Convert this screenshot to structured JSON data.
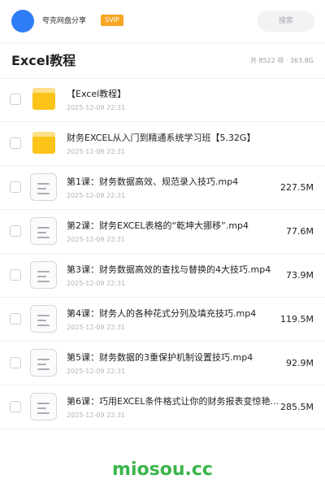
{
  "header": {
    "user_name": "夸克网盘分享",
    "badge": "SVIP",
    "search_label": "搜索"
  },
  "page": {
    "title": "Excel教程",
    "summary": "共 8522 项 · 363.8G"
  },
  "files": [
    {
      "type": "folder",
      "name": "【Excel教程】",
      "date": "2025-12-09 22:31",
      "size": ""
    },
    {
      "type": "folder",
      "name": "财务EXCEL从入门到精通系统学习班【5.32G】",
      "date": "2025-12-09 22:31",
      "size": ""
    },
    {
      "type": "file",
      "name": "第1课：财务数据高效、规范录入技巧.mp4",
      "date": "2025-12-09 22:31",
      "size": "227.5M"
    },
    {
      "type": "file",
      "name": "第2课：财务EXCEL表格的“乾坤大挪移”.mp4",
      "date": "2025-12-09 22:31",
      "size": "77.6M"
    },
    {
      "type": "file",
      "name": "第3课：财务数据高效的查找与替换的4大技巧.mp4",
      "date": "2025-12-09 22:31",
      "size": "73.9M"
    },
    {
      "type": "file",
      "name": "第4课：财务人的各种花式分列及填充技巧.mp4",
      "date": "2025-12-09 22:31",
      "size": "119.5M"
    },
    {
      "type": "file",
      "name": "第5课：财务数据的3重保护机制设置技巧.mp4",
      "date": "2025-12-09 22:31",
      "size": "92.9M"
    },
    {
      "type": "file",
      "name": "第6课：巧用EXCEL条件格式让你的财务报表变惊艳…",
      "date": "2025-12-09 22:31",
      "size": "285.5M"
    }
  ],
  "watermark": "miosou.cc",
  "colors": {
    "avatar": "#2f7df6",
    "badge": "#f6a623",
    "folder": "#fcc419",
    "watermark": "#3ab54a"
  }
}
